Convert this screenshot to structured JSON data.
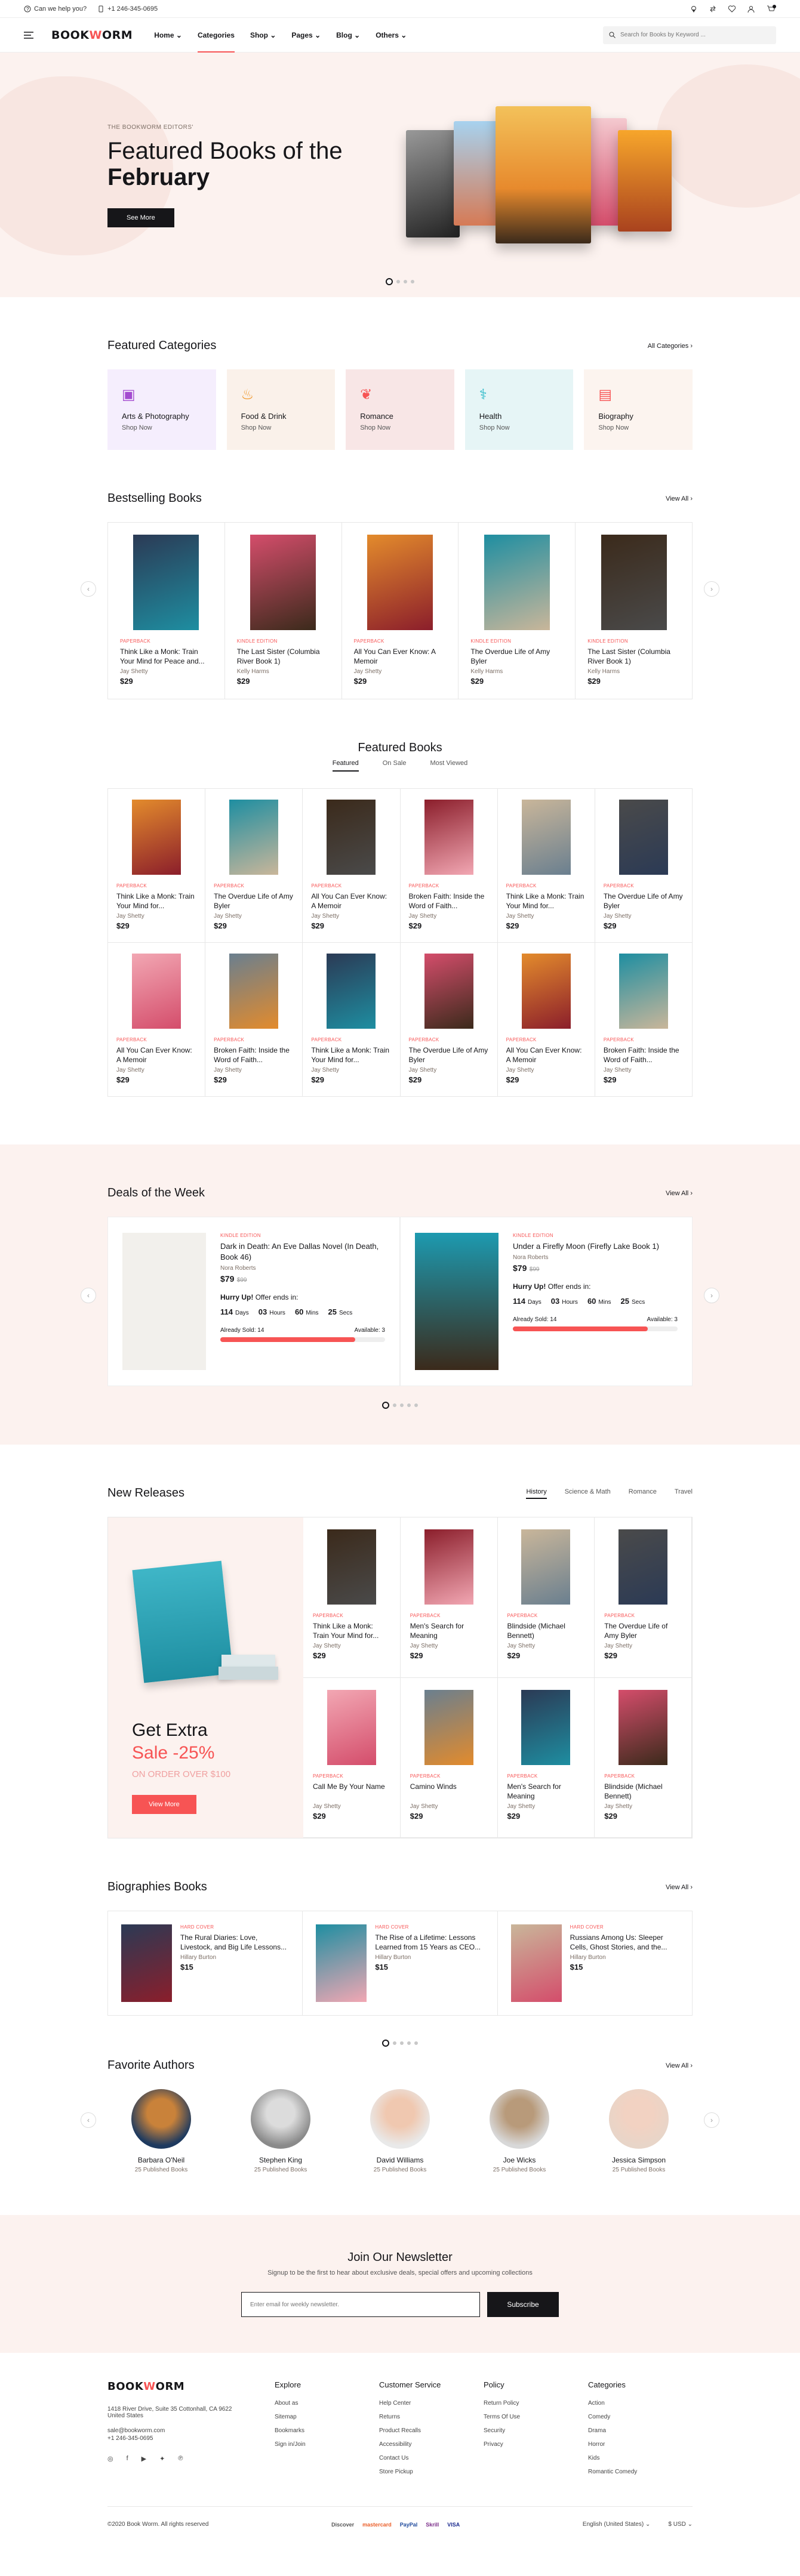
{
  "topbar": {
    "help": "Can we help you?",
    "phone": "+1 246-345-0695"
  },
  "header": {
    "logo_a": "BOOK",
    "logo_b": "W",
    "logo_c": "ORM",
    "nav": [
      "Home",
      "Categories",
      "Shop",
      "Pages",
      "Blog",
      "Others"
    ],
    "search_placeholder": "Search for Books by Keyword ..."
  },
  "hero": {
    "eyebrow": "THE BOOKWORM EDITORS'",
    "title_a": "Featured Books of the",
    "title_b": "February",
    "button": "See More"
  },
  "categories": {
    "title": "Featured Categories",
    "all": "All Categories",
    "items": [
      {
        "name": "Arts & Photography",
        "link": "Shop Now",
        "bg": "#f5eefd",
        "color": "#a34bcf"
      },
      {
        "name": "Food & Drink",
        "link": "Shop Now",
        "bg": "#faf1ea",
        "color": "#f0921e"
      },
      {
        "name": "Romance",
        "link": "Shop Now",
        "bg": "#f8e6e6",
        "color": "#f75454"
      },
      {
        "name": "Health",
        "link": "Shop Now",
        "bg": "#e6f5f6",
        "color": "#27b7c7"
      },
      {
        "name": "Biography",
        "link": "Shop Now",
        "bg": "#fcf4ef",
        "color": "#f75454"
      }
    ]
  },
  "bestselling": {
    "title": "Bestselling Books",
    "all": "View All",
    "items": [
      {
        "fmt": "PAPERBACK",
        "title": "Think Like a Monk: Train Your Mind for Peace and...",
        "author": "Jay Shetty",
        "price": "$29"
      },
      {
        "fmt": "KINDLE EDITION",
        "title": "The Last Sister (Columbia River Book 1)",
        "author": "Kelly Harms",
        "price": "$29"
      },
      {
        "fmt": "PAPERBACK",
        "title": "All You Can Ever Know: A Memoir",
        "author": "Jay Shetty",
        "price": "$29"
      },
      {
        "fmt": "KINDLE EDITION",
        "title": "The Overdue Life of Amy Byler",
        "author": "Kelly Harms",
        "price": "$29"
      },
      {
        "fmt": "KINDLE EDITION",
        "title": "The Last Sister (Columbia River Book 1)",
        "author": "Kelly Harms",
        "price": "$29"
      }
    ]
  },
  "featured": {
    "title": "Featured Books",
    "tabs": [
      "Featured",
      "On Sale",
      "Most Viewed"
    ],
    "items": [
      {
        "fmt": "PAPERBACK",
        "title": "Think Like a Monk: Train Your Mind for...",
        "author": "Jay Shetty",
        "price": "$29"
      },
      {
        "fmt": "PAPERBACK",
        "title": "The Overdue Life of Amy Byler",
        "author": "Jay Shetty",
        "price": "$29"
      },
      {
        "fmt": "PAPERBACK",
        "title": "All You Can Ever Know: A Memoir",
        "author": "Jay Shetty",
        "price": "$29"
      },
      {
        "fmt": "PAPERBACK",
        "title": "Broken Faith: Inside the Word of Faith...",
        "author": "Jay Shetty",
        "price": "$29"
      },
      {
        "fmt": "PAPERBACK",
        "title": "Think Like a Monk: Train Your Mind for...",
        "author": "Jay Shetty",
        "price": "$29"
      },
      {
        "fmt": "PAPERBACK",
        "title": "The Overdue Life of Amy Byler",
        "author": "Jay Shetty",
        "price": "$29"
      },
      {
        "fmt": "PAPERBACK",
        "title": "All You Can Ever Know: A Memoir",
        "author": "Jay Shetty",
        "price": "$29"
      },
      {
        "fmt": "PAPERBACK",
        "title": "Broken Faith: Inside the Word of Faith...",
        "author": "Jay Shetty",
        "price": "$29"
      },
      {
        "fmt": "PAPERBACK",
        "title": "Think Like a Monk: Train Your Mind for...",
        "author": "Jay Shetty",
        "price": "$29"
      },
      {
        "fmt": "PAPERBACK",
        "title": "The Overdue Life of Amy Byler",
        "author": "Jay Shetty",
        "price": "$29"
      },
      {
        "fmt": "PAPERBACK",
        "title": "All You Can Ever Know: A Memoir",
        "author": "Jay Shetty",
        "price": "$29"
      },
      {
        "fmt": "PAPERBACK",
        "title": "Broken Faith: Inside the Word of Faith...",
        "author": "Jay Shetty",
        "price": "$29"
      }
    ]
  },
  "deals": {
    "title": "Deals of the Week",
    "all": "View All",
    "items": [
      {
        "fmt": "KINDLE EDITION",
        "title": "Dark in Death: An Eve Dallas Novel (In Death, Book 46)",
        "author": "Nora Roberts",
        "price": "$79",
        "old": "$99",
        "hurry": "Hurry Up!",
        "ends": "Offer ends in:",
        "days": "114",
        "hours": "03",
        "mins": "60",
        "secs": "25",
        "sold": "Already Sold: 14",
        "avail": "Available: 3",
        "progress": 0.82
      },
      {
        "fmt": "KINDLE EDITION",
        "title": "Under a Firefly Moon (Firefly Lake Book 1)",
        "author": "Nora Roberts",
        "price": "$79",
        "old": "$99",
        "hurry": "Hurry Up!",
        "ends": "Offer ends in:",
        "days": "114",
        "hours": "03",
        "mins": "60",
        "secs": "25",
        "sold": "Already Sold: 14",
        "avail": "Available: 3",
        "progress": 0.82
      }
    ],
    "labels": {
      "days": "Days",
      "hours": "Hours",
      "mins": "Mins",
      "secs": "Secs"
    }
  },
  "releases": {
    "title": "New Releases",
    "tabs": [
      "History",
      "Science & Math",
      "Romance",
      "Travel"
    ],
    "banner_a": "Get Extra",
    "banner_b": "Sale -25%",
    "banner_c": "ON ORDER OVER $100",
    "banner_btn": "View More",
    "items": [
      {
        "fmt": "PAPERBACK",
        "title": "Think Like a Monk: Train Your Mind for...",
        "author": "Jay Shetty",
        "price": "$29"
      },
      {
        "fmt": "PAPERBACK",
        "title": "Men's Search for Meaning",
        "author": "Jay Shetty",
        "price": "$29"
      },
      {
        "fmt": "PAPERBACK",
        "title": "Blindside (Michael Bennett)",
        "author": "Jay Shetty",
        "price": "$29"
      },
      {
        "fmt": "PAPERBACK",
        "title": "The Overdue Life of Amy Byler",
        "author": "Jay Shetty",
        "price": "$29"
      },
      {
        "fmt": "PAPERBACK",
        "title": "Call Me By Your Name",
        "author": "Jay Shetty",
        "price": "$29"
      },
      {
        "fmt": "PAPERBACK",
        "title": "Camino Winds",
        "author": "Jay Shetty",
        "price": "$29"
      },
      {
        "fmt": "PAPERBACK",
        "title": "Men's Search for Meaning",
        "author": "Jay Shetty",
        "price": "$29"
      },
      {
        "fmt": "PAPERBACK",
        "title": "Blindside (Michael Bennett)",
        "author": "Jay Shetty",
        "price": "$29"
      }
    ]
  },
  "bio": {
    "title": "Biographies Books",
    "all": "View All",
    "items": [
      {
        "fmt": "HARD COVER",
        "title": "The Rural Diaries: Love, Livestock, and Big Life Lessons...",
        "author": "Hillary Burton",
        "price": "$15"
      },
      {
        "fmt": "HARD COVER",
        "title": "The Rise of a Lifetime: Lessons Learned from 15 Years as CEO...",
        "author": "Hillary Burton",
        "price": "$15"
      },
      {
        "fmt": "HARD COVER",
        "title": "Russians Among Us: Sleeper Cells, Ghost Stories, and the...",
        "author": "Hillary Burton",
        "price": "$15"
      }
    ]
  },
  "authors": {
    "title": "Favorite Authors",
    "all": "View All",
    "items": [
      {
        "name": "Barbara O'Neil",
        "count": "25 Published Books"
      },
      {
        "name": "Stephen King",
        "count": "25 Published Books"
      },
      {
        "name": "David Williams",
        "count": "25 Published Books"
      },
      {
        "name": "Joe Wicks",
        "count": "25 Published Books"
      },
      {
        "name": "Jessica Simpson",
        "count": "25 Published Books"
      }
    ]
  },
  "newsletter": {
    "title": "Join Our Newsletter",
    "text": "Signup to be the first to hear about exclusive deals, special offers and upcoming collections",
    "placeholder": "Enter email for weekly newsletter.",
    "button": "Subscribe"
  },
  "footer": {
    "address": [
      "1418 River Drive, Suite 35 Cottonhall, CA 9622",
      "United States"
    ],
    "email": "sale@bookworm.com",
    "phone": "+1 246-345-0695",
    "cols": [
      {
        "title": "Explore",
        "links": [
          "About as",
          "Sitemap",
          "Bookmarks",
          "Sign in/Join"
        ]
      },
      {
        "title": "Customer Service",
        "links": [
          "Help Center",
          "Returns",
          "Product Recalls",
          "Accessibility",
          "Contact Us",
          "Store Pickup"
        ]
      },
      {
        "title": "Policy",
        "links": [
          "Return Policy",
          "Terms Of Use",
          "Security",
          "Privacy"
        ]
      },
      {
        "title": "Categories",
        "links": [
          "Action",
          "Comedy",
          "Drama",
          "Horror",
          "Kids",
          "Romantic Comedy"
        ]
      }
    ],
    "copyright": "©2020 Book Worm. All rights reserved",
    "pay": [
      "Discover",
      "mastercard",
      "PayPal",
      "Skrill",
      "VISA"
    ],
    "lang": "English (United States)",
    "currency": "$ USD"
  }
}
